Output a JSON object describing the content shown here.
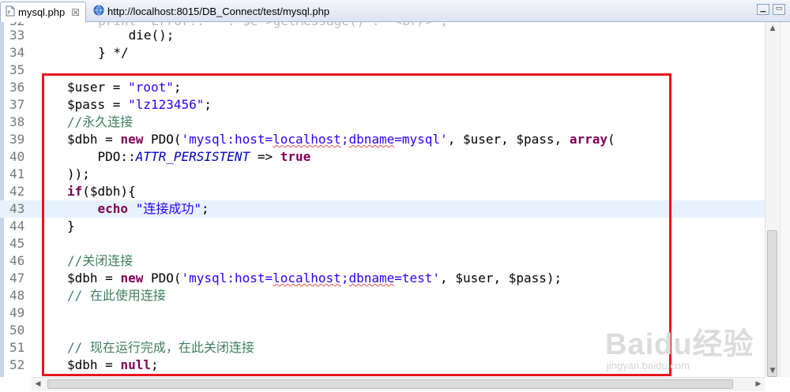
{
  "tabs": [
    {
      "label": "mysql.php",
      "close": "☒"
    },
    {
      "label": "http://localhost:8015/DB_Connect/test/mysql.php"
    }
  ],
  "lines": [
    {
      "num": "33",
      "code": "            die();"
    },
    {
      "num": "34",
      "code": "        } */"
    },
    {
      "num": "35",
      "code": ""
    },
    {
      "num": "36"
    },
    {
      "num": "37"
    },
    {
      "num": "38"
    },
    {
      "num": "39"
    },
    {
      "num": "40"
    },
    {
      "num": "41"
    },
    {
      "num": "42"
    },
    {
      "num": "43"
    },
    {
      "num": "44"
    },
    {
      "num": "45"
    },
    {
      "num": "46"
    },
    {
      "num": "47"
    },
    {
      "num": "48"
    },
    {
      "num": "49"
    },
    {
      "num": "50"
    },
    {
      "num": "51"
    },
    {
      "num": "52"
    }
  ],
  "code": {
    "l36_var": "$user",
    "l36_eq": " = ",
    "l36_str": "\"root\"",
    "l36_end": ";",
    "l37_var": "$pass",
    "l37_eq": " = ",
    "l37_str": "\"lz123456\"",
    "l37_end": ";",
    "l38_cmt": "//永久连接",
    "l39_a": "$dbh = ",
    "l39_new": "new",
    "l39_cls": " PDO(",
    "l39_s1": "'mysql:host=",
    "l39_s2": "localhost",
    "l39_s3": ";",
    "l39_s4": "dbname",
    "l39_s5": "=mysql'",
    "l39_b": ", $user, $pass, ",
    "l39_arr": "array",
    "l39_c": "(",
    "l40_a": "    PDO::",
    "l40_const": "ATTR_PERSISTENT",
    "l40_b": " => ",
    "l40_true": "true",
    "l41": "));",
    "l42_if": "if",
    "l42_rest": "($dbh){",
    "l43_echo": "    echo",
    "l43_sp": " ",
    "l43_str": "\"连接成功\"",
    "l43_end": ";",
    "l44": "}",
    "l46_cmt": "//关闭连接",
    "l47_a": "$dbh = ",
    "l47_new": "new",
    "l47_cls": " PDO(",
    "l47_s1": "'mysql:host=",
    "l47_s2": "localhost",
    "l47_s3": ";",
    "l47_s4": "dbname",
    "l47_s5": "=test'",
    "l47_b": ", $user, $pass);",
    "l48_cmt": "// 在此使用连接",
    "l51_cmt": "// 现在运行完成，在此关闭连接",
    "l52_a": "$dbh = ",
    "l52_null": "null",
    "l52_end": ";"
  },
  "watermark": {
    "big": "Baidu经验",
    "small": "jingyan.baidu.com"
  },
  "colors": {
    "keyword": "#7f0055",
    "string": "#2a00ff",
    "comment": "#3f7f5f",
    "highlight": "#e8f2fe",
    "box": "#e8141d"
  }
}
